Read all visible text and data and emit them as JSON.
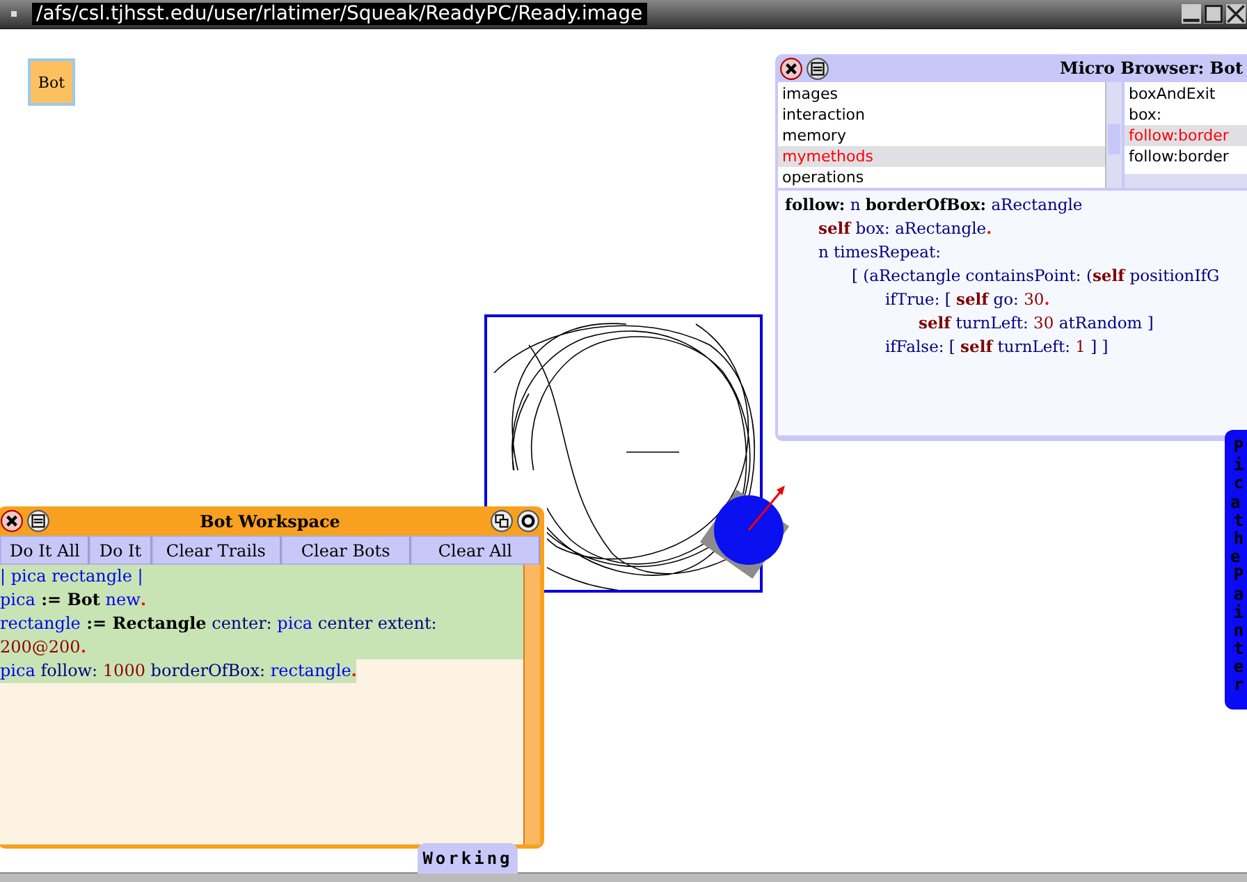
{
  "window": {
    "title": "/afs/csl.tjhsst.edu/user/rlatimer/Squeak/ReadyPC/Ready.image"
  },
  "desktop_tile": {
    "label": "Bot"
  },
  "browser": {
    "title": "Micro Browser: Bot",
    "categories": [
      {
        "label": "images",
        "selected": false
      },
      {
        "label": "interaction",
        "selected": false
      },
      {
        "label": "memory",
        "selected": false
      },
      {
        "label": "mymethods",
        "selected": true
      },
      {
        "label": "operations",
        "selected": false
      }
    ],
    "methods": [
      {
        "label": "boxAndExit",
        "selected": false
      },
      {
        "label": "box:",
        "selected": false
      },
      {
        "label": "follow:border",
        "selected": true
      },
      {
        "label": "follow:border",
        "selected": false
      }
    ],
    "code": [
      {
        "tokens": [
          {
            "t": "follow:",
            "kind": "kw"
          },
          {
            "t": " n ",
            "kind": "plain"
          },
          {
            "t": "borderOfBox:",
            "kind": "kw"
          },
          {
            "t": " aRectangle",
            "kind": "plain"
          }
        ],
        "children": [
          {
            "tokens": [
              {
                "t": "self",
                "kind": "self"
              },
              {
                "t": " box: aRectangle",
                "kind": "plain"
              },
              {
                "t": ".",
                "kind": "dot"
              }
            ]
          },
          {
            "tokens": [
              {
                "t": "n timesRepeat:",
                "kind": "plain"
              }
            ],
            "children": [
              {
                "tokens": [
                  {
                    "t": "[ (aRectangle containsPoint: (",
                    "kind": "plain"
                  },
                  {
                    "t": "self",
                    "kind": "self"
                  },
                  {
                    "t": " positionIfG",
                    "kind": "plain"
                  }
                ],
                "children": [
                  {
                    "tokens": [
                      {
                        "t": "ifTrue: [ ",
                        "kind": "plain"
                      },
                      {
                        "t": "self",
                        "kind": "self"
                      },
                      {
                        "t": " go: ",
                        "kind": "plain"
                      },
                      {
                        "t": "30",
                        "kind": "num"
                      },
                      {
                        "t": ".",
                        "kind": "dot"
                      }
                    ],
                    "children": [
                      {
                        "tokens": [
                          {
                            "t": "self",
                            "kind": "self"
                          },
                          {
                            "t": " turnLeft: ",
                            "kind": "plain"
                          },
                          {
                            "t": "30",
                            "kind": "num"
                          },
                          {
                            "t": " atRandom ]",
                            "kind": "plain"
                          }
                        ]
                      }
                    ]
                  },
                  {
                    "tokens": [
                      {
                        "t": "ifFalse: [ ",
                        "kind": "plain"
                      },
                      {
                        "t": "self",
                        "kind": "self"
                      },
                      {
                        "t": " turnLeft: ",
                        "kind": "plain"
                      },
                      {
                        "t": "1",
                        "kind": "num"
                      },
                      {
                        "t": " ] ]",
                        "kind": "plain"
                      }
                    ]
                  }
                ]
              }
            ]
          }
        ]
      }
    ]
  },
  "workspace": {
    "title": "Bot Workspace",
    "buttons": [
      "Do It All",
      "Do It",
      "Clear Trails",
      "Clear Bots",
      "Clear All"
    ],
    "code": [
      {
        "highlighted": true,
        "tokens": [
          {
            "t": "| pica rectangle |",
            "kind": "var"
          }
        ]
      },
      {
        "highlighted": true,
        "tokens": [
          {
            "t": "pica",
            "kind": "var"
          },
          {
            "t": " := Bot",
            "kind": "kw"
          },
          {
            "t": " new",
            "kind": "var"
          },
          {
            "t": ".",
            "kind": "dot"
          }
        ]
      },
      {
        "highlighted": true,
        "tokens": [
          {
            "t": "rectangle",
            "kind": "var"
          },
          {
            "t": " := Rectangle",
            "kind": "kw"
          },
          {
            "t": " center: ",
            "kind": "plain"
          },
          {
            "t": "pica",
            "kind": "var"
          },
          {
            "t": " center extent:",
            "kind": "plain"
          }
        ]
      },
      {
        "highlighted": true,
        "tokens": [
          {
            "t": "200@200",
            "kind": "num"
          },
          {
            "t": ".",
            "kind": "dot"
          }
        ]
      },
      {
        "highlighted": true,
        "tokens": [
          {
            "t": "pica",
            "kind": "var"
          },
          {
            "t": " follow: ",
            "kind": "plain"
          },
          {
            "t": "1000",
            "kind": "num"
          },
          {
            "t": " borderOfBox: ",
            "kind": "plain"
          },
          {
            "t": "rectangle",
            "kind": "var"
          },
          {
            "t": ".",
            "kind": "dot"
          }
        ]
      }
    ]
  },
  "status_tab": "Working",
  "flap": "Pica the Painter"
}
